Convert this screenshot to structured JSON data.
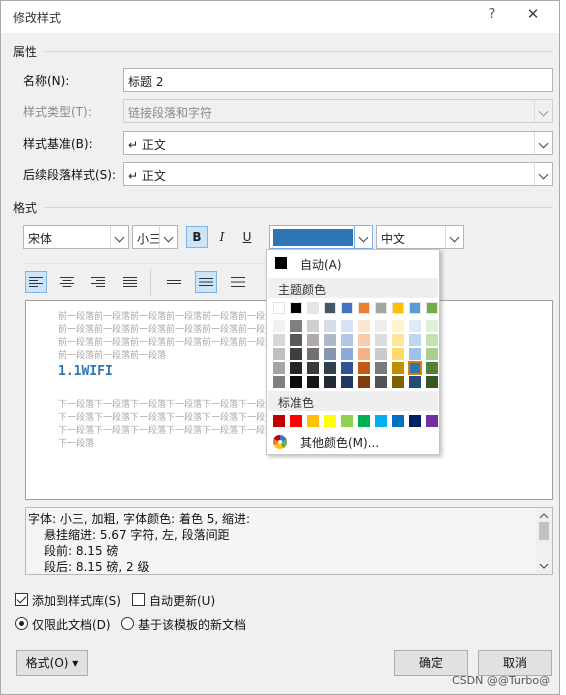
{
  "dialog": {
    "title": "修改样式",
    "help": "?",
    "close": "✕"
  },
  "properties": {
    "section": "属性",
    "name_label": "名称(N):",
    "name_value": "标题 2",
    "type_label": "样式类型(T):",
    "type_value": "链接段落和字符",
    "based_label": "样式基准(B):",
    "based_value": "↵ 正文",
    "next_label": "后续段落样式(S):",
    "next_value": "↵ 正文"
  },
  "format": {
    "section": "格式",
    "font": "宋体",
    "size": "小三",
    "bold": "B",
    "italic": "I",
    "underline": "U",
    "script": "中文"
  },
  "preview": {
    "prev_para": "前一段落前一段落前一段落前一段落前一段落前一段落前一段落前一段落\n前一段落前一段落前一段落前一段落前一段落前一段落前一段落前一段落\n前一段落前一段落前一段落前一段落前一段落前一段落前一段落前一段落\n前一段落前一段落前一段落",
    "heading": "1.1WIFI",
    "next_para": "下一段落下一段落下一段落下一段落下一段落下一段落下一段落下一段落\n下一段落下一段落下一段落下一段落下一段落下一段落下一段落下一段落\n下一段落下一段落下一段落下一段落下一段落下一段落下一段落下一段落\n下一段落"
  },
  "description": {
    "line1": "字体: 小三, 加粗, 字体颜色: 着色 5, 缩进:",
    "line2": "悬挂缩进: 5.67 字符, 左, 段落间距",
    "line3": "段前: 8.15 磅",
    "line4": "段后: 8.15 磅, 2 级"
  },
  "options": {
    "add_gallery": "添加到样式库(S)",
    "auto_update": "自动更新(U)",
    "only_doc": "仅限此文档(D)",
    "new_docs": "基于该模板的新文档"
  },
  "buttons": {
    "format": "格式(O) ▾",
    "ok": "确定",
    "cancel": "取消"
  },
  "color_popup": {
    "automatic": "自动(A)",
    "theme_header": "主题颜色",
    "standard_header": "标准色",
    "more": "其他颜色(M)...",
    "selected_color": "#2e75b6",
    "theme_top": [
      "#ffffff",
      "#000000",
      "#e7e6e6",
      "#44546a",
      "#4472c4",
      "#ed7d31",
      "#a5a5a5",
      "#ffc000",
      "#5b9bd5",
      "#70ad47"
    ],
    "theme_shades": [
      [
        "#f2f2f2",
        "#7f7f7f",
        "#d0cece",
        "#d6dce4",
        "#d9e2f3",
        "#fbe5d5",
        "#ededed",
        "#fff2cc",
        "#deebf6",
        "#e2efd9"
      ],
      [
        "#d8d8d8",
        "#595959",
        "#aeaaaa",
        "#adb9ca",
        "#b4c6e7",
        "#f7cbac",
        "#dbdbdb",
        "#fee599",
        "#bdd7ee",
        "#c5e0b3"
      ],
      [
        "#bfbfbf",
        "#3f3f3f",
        "#757070",
        "#8496b0",
        "#8eaadb",
        "#f4b183",
        "#c9c9c9",
        "#ffd965",
        "#9dc3e6",
        "#a8d08d"
      ],
      [
        "#a5a5a5",
        "#262626",
        "#3a3838",
        "#323f4f",
        "#2f5496",
        "#c55a11",
        "#7b7b7b",
        "#bf8f00",
        "#2e75b6",
        "#538135"
      ],
      [
        "#7f7f7f",
        "#0c0c0c",
        "#171616",
        "#222a35",
        "#1f3864",
        "#833c0b",
        "#525252",
        "#7f6000",
        "#1e4e79",
        "#375623"
      ]
    ],
    "standard": [
      "#c00000",
      "#ff0000",
      "#ffc000",
      "#ffff00",
      "#92d050",
      "#00b050",
      "#00b0f0",
      "#0070c0",
      "#002060",
      "#7030a0"
    ]
  },
  "watermark": "CSDN @@Turbo@"
}
